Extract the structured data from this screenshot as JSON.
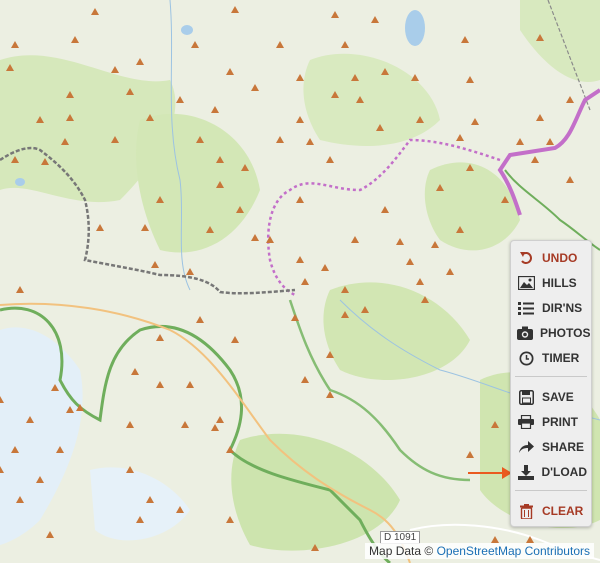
{
  "map": {
    "attribution_prefix": "Map Data ©",
    "attribution_link": "OpenStreetMap Contributors",
    "road_label": "D 1091"
  },
  "toolbar": {
    "items": [
      {
        "label": "UNDO",
        "icon": "undo-icon"
      },
      {
        "label": "HILLS",
        "icon": "image-icon"
      },
      {
        "label": "DIR'NS",
        "icon": "list-icon"
      },
      {
        "label": "PHOTOS",
        "icon": "camera-icon"
      },
      {
        "label": "TIMER",
        "icon": "clock-icon"
      },
      {
        "label": "SAVE",
        "icon": "floppy-disk-icon"
      },
      {
        "label": "PRINT",
        "icon": "printer-icon"
      },
      {
        "label": "SHARE",
        "icon": "share-arrow-icon"
      },
      {
        "label": "D'LOAD",
        "icon": "download-icon"
      },
      {
        "label": "CLEAR",
        "icon": "trash-icon"
      }
    ],
    "accent_color": "#a63a25"
  },
  "colors": {
    "land": "#ecefe2",
    "forest": "#cfe5b0",
    "glacier": "#e3eff8",
    "park_border": "#6fae5c",
    "boundary_purple": "#c36fc9",
    "boundary_dark": "#777777",
    "road": "#f2c27f",
    "peak": "#c8773a",
    "arrow": "#ea5a1f"
  }
}
